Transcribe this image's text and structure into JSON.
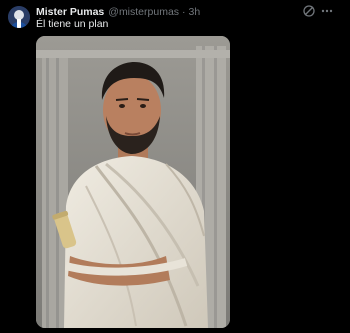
{
  "author": {
    "display_name": "Mister Pumas",
    "handle": "@misterpumas",
    "separator": "·",
    "time": "3h"
  },
  "tweet": {
    "text": "Él tiene un plan"
  },
  "icons": {
    "grok": "grok-icon",
    "more": "more-icon",
    "avatar": "avatar-image"
  },
  "colors": {
    "background": "#000000",
    "primary_text": "#e7e9ea",
    "secondary_text": "#71767b"
  }
}
